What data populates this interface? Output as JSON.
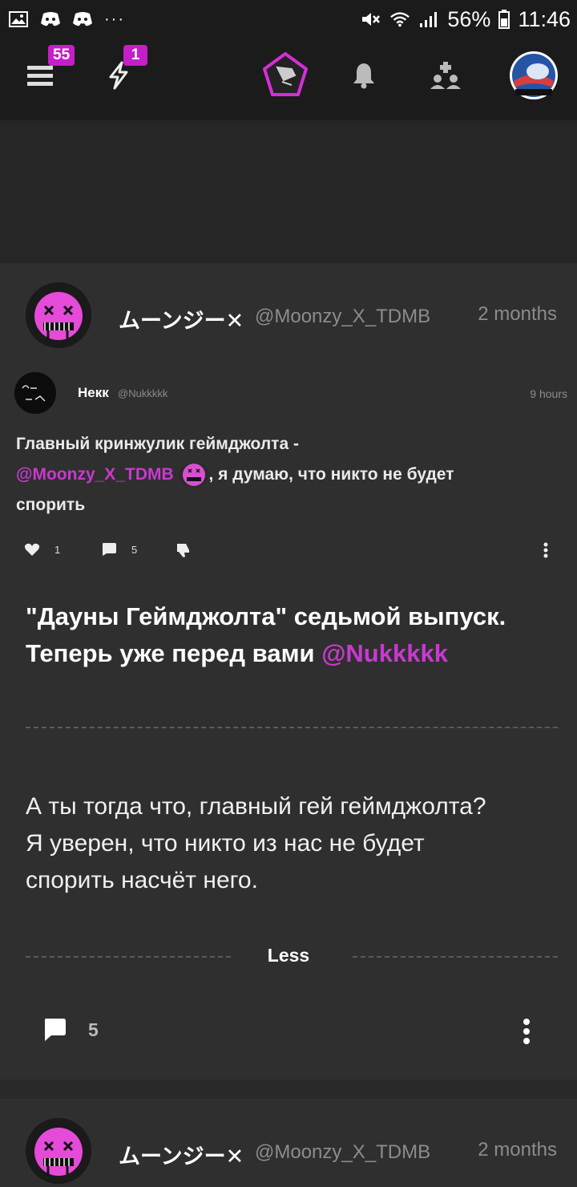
{
  "status_bar": {
    "battery": "56%",
    "time": "11:46",
    "more": "···"
  },
  "header": {
    "menu_badge": "55",
    "activity_badge": "1"
  },
  "post": {
    "author_name": "ムーンジー✕",
    "author_handle": "@Moonzy_X_TDMB",
    "time": "2 months",
    "quote": {
      "author_name": "Некк",
      "author_handle": "@Nukkkkk",
      "time": "9 hours",
      "text_before": "Главный кринжулик геймджолта -",
      "mention": "@Moonzy_X_TDMB",
      "text_after": ", я думаю, что никто не будет",
      "text_last": "спорить",
      "likes": "1",
      "comments": "5"
    },
    "title_line1": "\"Дауны Геймджолта\" седьмой выпуск.",
    "title_line2": "Теперь уже перед вами",
    "title_mention": "@Nukkkkk",
    "body_line1": "А ты тогда что, главный гей геймджолта?",
    "body_line2": "Я уверен, что никто из нас не будет",
    "body_line3": "спорить насчёт него.",
    "less_label": "Less",
    "comment_count": "5"
  },
  "next_post": {
    "author_name": "ムーンジー✕",
    "author_handle": "@Moonzy_X_TDMB",
    "time": "2 months"
  },
  "colors": {
    "accent": "#c51fc9",
    "background": "#292929",
    "card": "#2f2f2f"
  }
}
